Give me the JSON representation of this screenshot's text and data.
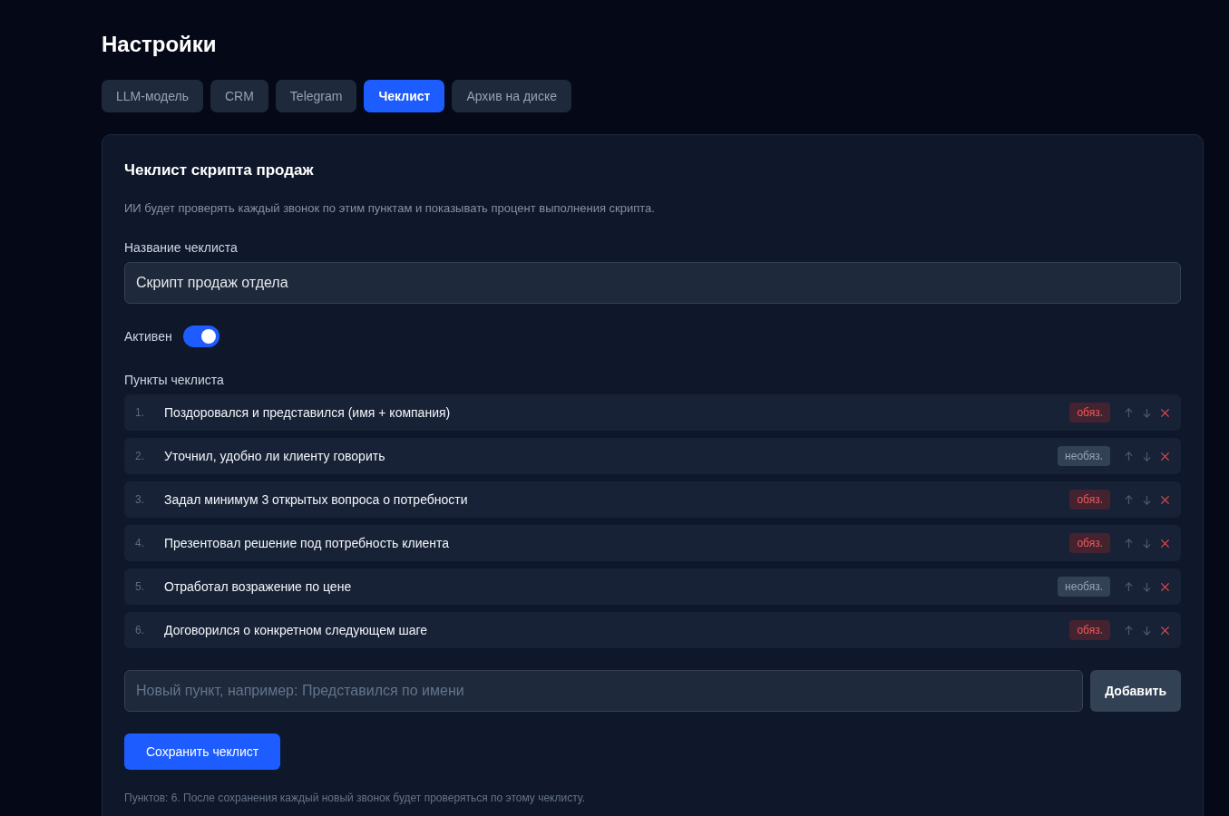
{
  "page_title": "Настройки",
  "tabs": [
    {
      "label": "LLM-модель",
      "selected": false
    },
    {
      "label": "CRM",
      "selected": false
    },
    {
      "label": "Telegram",
      "selected": false
    },
    {
      "label": "Чеклист",
      "selected": true
    },
    {
      "label": "Архив на диске",
      "selected": false
    }
  ],
  "card": {
    "title": "Чеклист скрипта продаж",
    "description": "ИИ будет проверять каждый звонок по этим пунктам и показывать процент выполнения скрипта.",
    "name_label": "Название чеклиста",
    "name_value": "Скрипт продаж отдела",
    "active_label": "Активен",
    "active": true,
    "items_label": "Пункты чеклиста",
    "items": [
      {
        "number": "1.",
        "text": "Поздоровался и представился (имя + компания)",
        "badge": "обяз.",
        "required": true
      },
      {
        "number": "2.",
        "text": "Уточнил, удобно ли клиенту говорить",
        "badge": "необяз.",
        "required": false
      },
      {
        "number": "3.",
        "text": "Задал минимум 3 открытых вопроса о потребности",
        "badge": "обяз.",
        "required": true
      },
      {
        "number": "4.",
        "text": "Презентовал решение под потребность клиента",
        "badge": "обяз.",
        "required": true
      },
      {
        "number": "5.",
        "text": "Отработал возражение по цене",
        "badge": "необяз.",
        "required": false
      },
      {
        "number": "6.",
        "text": "Договорился о конкретном следующем шаге",
        "badge": "обяз.",
        "required": true
      }
    ],
    "new_item_placeholder": "Новый пункт, например: Представился по имени",
    "add_button": "Добавить",
    "save_button": "Сохранить чеклист",
    "footer_note": "Пунктов: 6. После сохранения каждый новый звонок будет проверяться по этому чеклисту."
  }
}
